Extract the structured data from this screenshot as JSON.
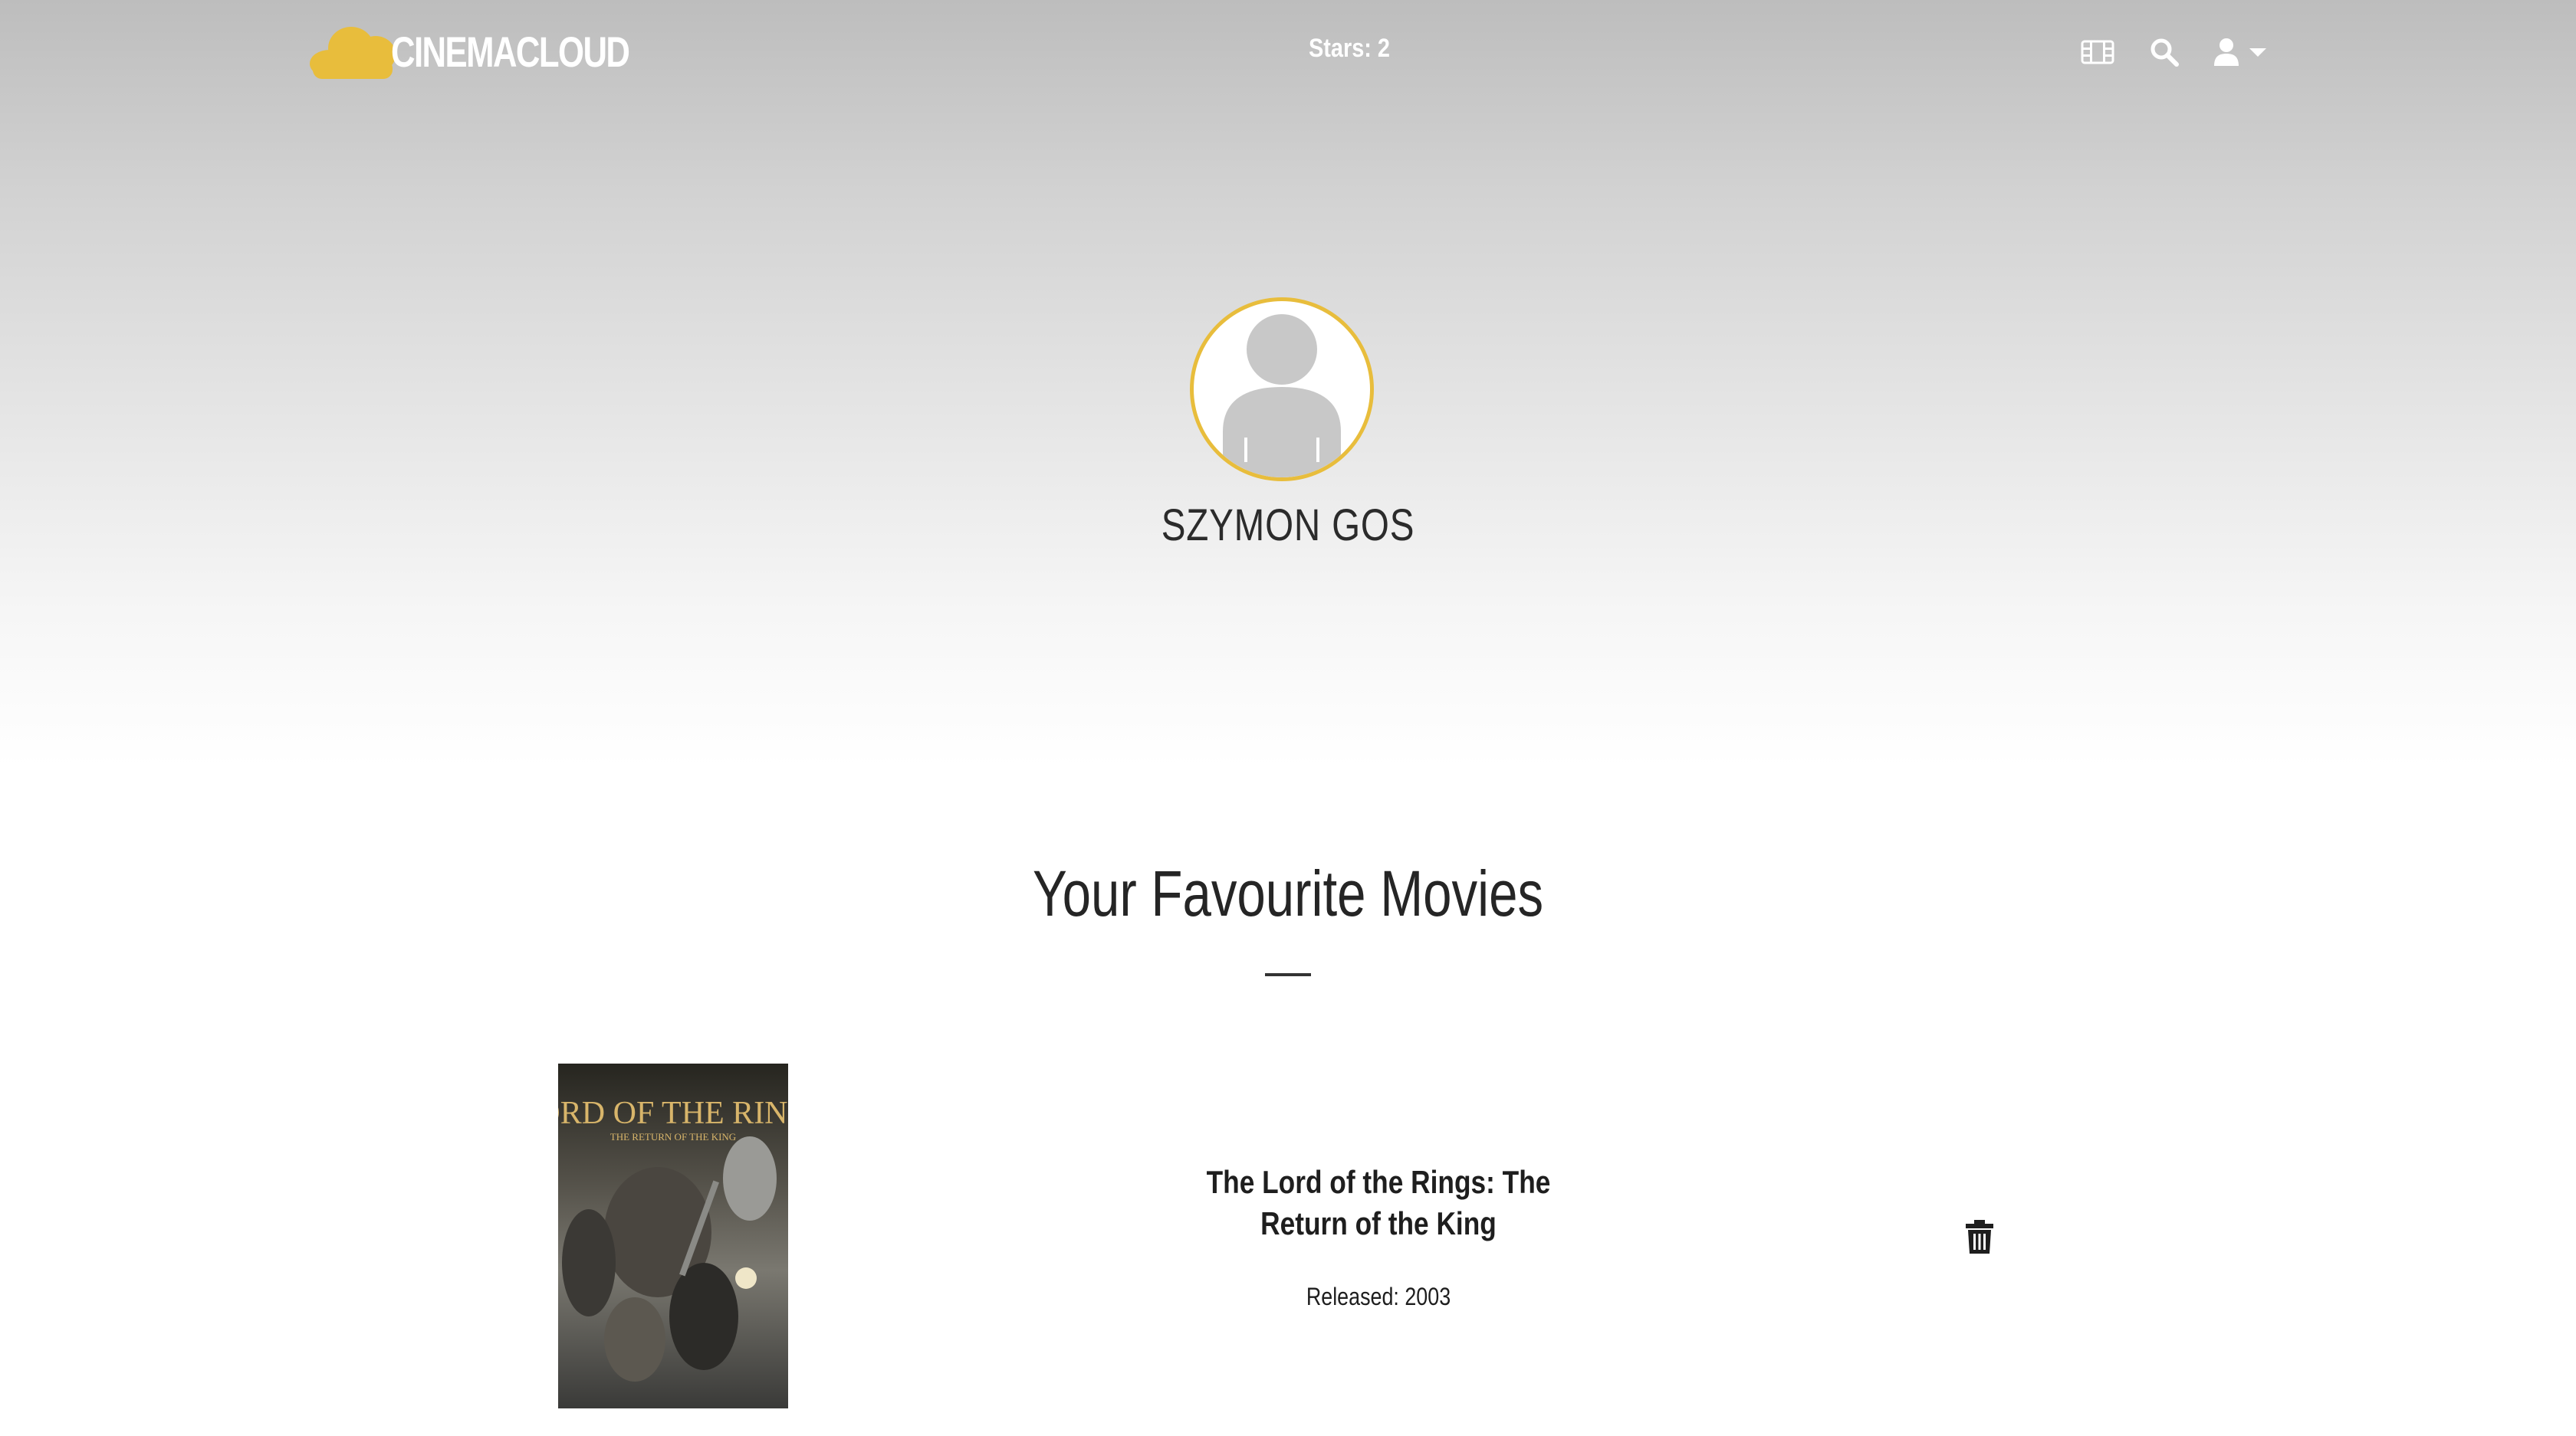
{
  "header": {
    "logo_text": "CINEMACLOUD",
    "stars_text": "Stars: 2",
    "icons": [
      "film-icon",
      "search-icon",
      "user-icon",
      "caret-down-icon"
    ]
  },
  "profile": {
    "username": "SZYMON GOS",
    "avatar_icon": "default-avatar-icon"
  },
  "favourites": {
    "title": "Your Favourite Movies",
    "movies": [
      {
        "title": "The Lord of the Rings: The Return of the King",
        "released": "Released: 2003",
        "poster_lettering": "THE LORD OF THE RINGS — THE RETURN OF THE KING",
        "delete_icon": "trash-icon"
      }
    ]
  },
  "colors": {
    "brand_yellow": "#e8bd3c",
    "hero_top": "#bdbdbd",
    "text_dark": "#252525"
  }
}
